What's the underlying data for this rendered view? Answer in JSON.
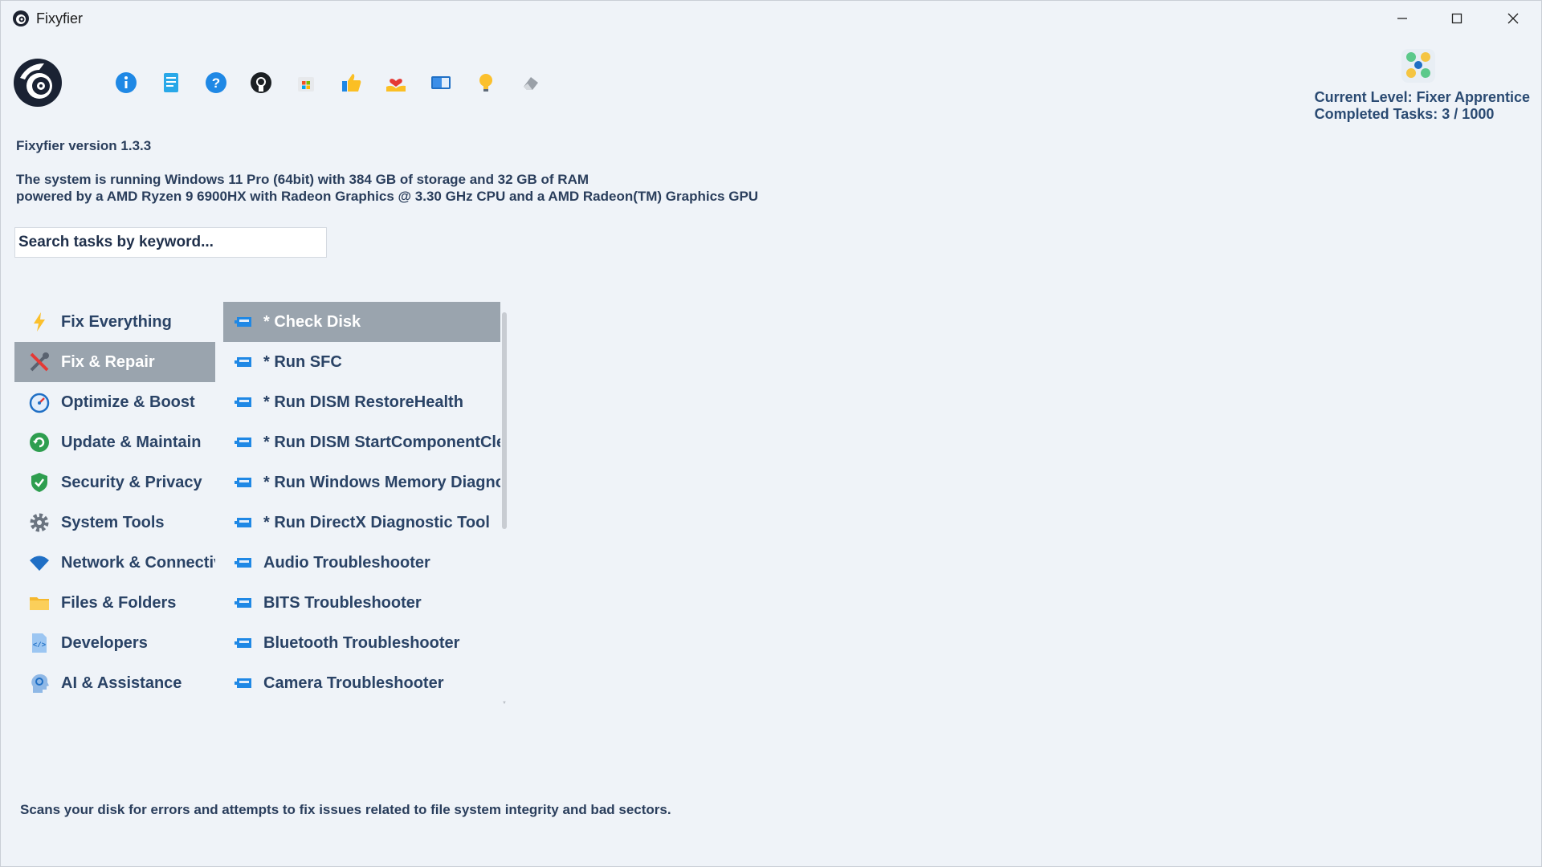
{
  "window": {
    "title": "Fixyfier"
  },
  "toolbar": {
    "icons": [
      "info-icon",
      "notes-icon",
      "help-icon",
      "github-icon",
      "windows-store-icon",
      "thumbs-up-icon",
      "donate-heart-icon",
      "window-icon",
      "lightbulb-icon",
      "eraser-icon"
    ]
  },
  "level": {
    "current": "Current Level: Fixer Apprentice",
    "completed": "Completed Tasks: 3 / 1000"
  },
  "info": {
    "version": "Fixyfier version 1.3.3",
    "system_line1": "The system is running Windows 11 Pro (64bit) with 384 GB of storage and 32 GB of RAM",
    "system_line2": "powered by a AMD Ryzen 9 6900HX with Radeon Graphics @ 3.30 GHz CPU and a AMD Radeon(TM) Graphics GPU"
  },
  "search": {
    "placeholder": "Search tasks by keyword..."
  },
  "categories": [
    {
      "label": "Fix Everything",
      "icon": "lightning-icon"
    },
    {
      "label": "Fix & Repair",
      "icon": "tools-icon",
      "selected": true
    },
    {
      "label": "Optimize & Boost",
      "icon": "speedometer-icon"
    },
    {
      "label": "Update & Maintain",
      "icon": "refresh-icon"
    },
    {
      "label": "Security & Privacy",
      "icon": "shield-icon"
    },
    {
      "label": "System Tools",
      "icon": "gear-icon"
    },
    {
      "label": "Network & Connectivity",
      "icon": "wifi-icon"
    },
    {
      "label": "Files & Folders",
      "icon": "folder-icon"
    },
    {
      "label": "Developers",
      "icon": "code-icon"
    },
    {
      "label": "AI & Assistance",
      "icon": "ai-head-icon"
    }
  ],
  "tasks": [
    {
      "label": "* Check Disk",
      "selected": true
    },
    {
      "label": "* Run SFC"
    },
    {
      "label": "* Run DISM RestoreHealth"
    },
    {
      "label": "* Run DISM StartComponentCleanup"
    },
    {
      "label": "* Run Windows Memory Diagnostic"
    },
    {
      "label": "* Run DirectX Diagnostic Tool"
    },
    {
      "label": "Audio Troubleshooter"
    },
    {
      "label": "BITS Troubleshooter"
    },
    {
      "label": "Bluetooth Troubleshooter"
    },
    {
      "label": "Camera Troubleshooter"
    }
  ],
  "description": "Scans your disk for errors and attempts to fix issues related to file system integrity and bad sectors."
}
